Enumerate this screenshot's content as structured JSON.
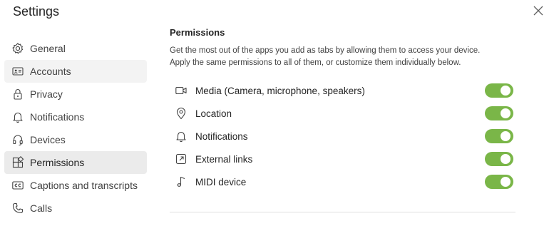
{
  "window": {
    "title": "Settings"
  },
  "sidebar": {
    "items": [
      {
        "label": "General",
        "icon": "gear-icon",
        "selected": false
      },
      {
        "label": "Accounts",
        "icon": "id-card-icon",
        "selected": false
      },
      {
        "label": "Privacy",
        "icon": "lock-icon",
        "selected": false
      },
      {
        "label": "Notifications",
        "icon": "bell-icon",
        "selected": false
      },
      {
        "label": "Devices",
        "icon": "headset-icon",
        "selected": false
      },
      {
        "label": "Permissions",
        "icon": "apps-icon",
        "selected": true
      },
      {
        "label": "Captions and transcripts",
        "icon": "cc-icon",
        "selected": false
      },
      {
        "label": "Calls",
        "icon": "phone-icon",
        "selected": false
      }
    ]
  },
  "main": {
    "heading": "Permissions",
    "description_line1": "Get the most out of the apps you add as tabs by allowing them to access your device.",
    "description_line2": "Apply the same permissions to all of them, or customize them individually below.",
    "permissions": [
      {
        "label": "Media (Camera, microphone, speakers)",
        "icon": "camera-icon",
        "enabled": true
      },
      {
        "label": "Location",
        "icon": "location-pin-icon",
        "enabled": true
      },
      {
        "label": "Notifications",
        "icon": "bell-icon",
        "enabled": true
      },
      {
        "label": "External links",
        "icon": "external-link-icon",
        "enabled": true
      },
      {
        "label": "MIDI device",
        "icon": "music-note-icon",
        "enabled": true
      }
    ]
  },
  "colors": {
    "toggle_on": "#7ab648",
    "selected_bg": "#ebebeb"
  }
}
